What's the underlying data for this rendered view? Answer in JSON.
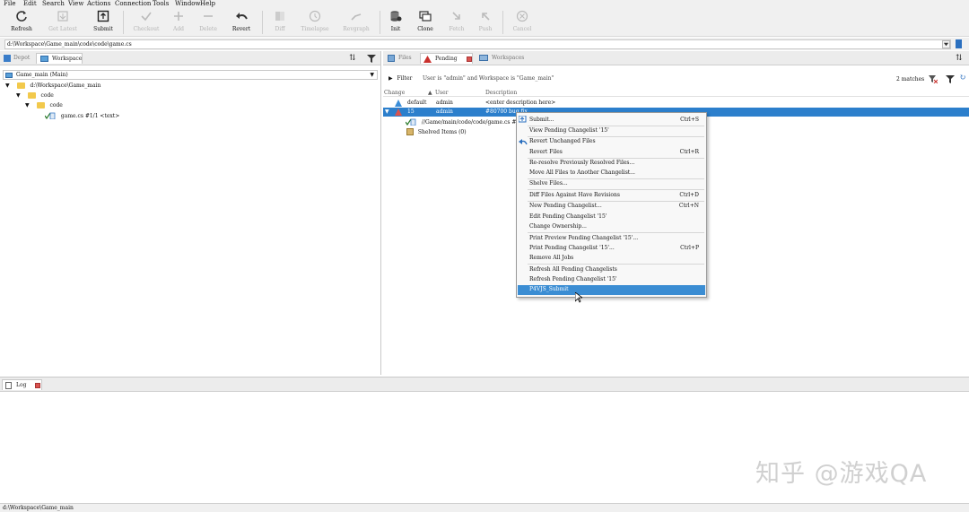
{
  "menu": [
    "File",
    "Edit",
    "Search",
    "View",
    "Actions",
    "Connection",
    "Tools",
    "Window",
    "Help"
  ],
  "toolbar": {
    "refresh": "Refresh",
    "get_latest": "Get Latest",
    "submit": "Submit",
    "checkout": "Checkout",
    "add": "Add",
    "delete": "Delete",
    "revert": "Revert",
    "diff": "Diff",
    "timelapse": "Timelapse",
    "revgraph": "Revgraph",
    "init": "Init",
    "clone": "Clone",
    "fetch": "Fetch",
    "push": "Push",
    "cancel": "Cancel"
  },
  "address": "d:\\Workspace\\Game_main\\code\\code\\game.cs",
  "left": {
    "tab_depot": "Depot",
    "tab_workspace": "Workspace",
    "workspace_select": "Game_main (Main)",
    "tree": {
      "root": "d:\\Workspace\\Game_main",
      "code1": "code",
      "code2": "code",
      "file": "game.cs #1/1 <text>"
    }
  },
  "right": {
    "tab_files": "Files",
    "tab_pending": "Pending",
    "tab_workspaces": "Workspaces",
    "filter_label": "Filter",
    "filter_text": "User is \"admin\" and Workspace is \"Game_main\"",
    "matches": "2 matches",
    "col_change": "Change",
    "col_user": "User",
    "col_description": "Description",
    "rows": [
      {
        "change": "default",
        "user": "admin",
        "description": "<enter description here>"
      },
      {
        "change": "15",
        "user": "admin",
        "description": "#80700 bug fix"
      }
    ],
    "file_path": "//Game/main/code/code/game.cs #",
    "shelved": "Shelved Items (0)"
  },
  "context_menu": {
    "items": [
      {
        "label": "Submit...",
        "shortcut": "Ctrl+S"
      },
      {
        "label": "View Pending Changelist '15'",
        "shortcut": ""
      },
      {
        "label": "Revert Unchanged Files",
        "shortcut": ""
      },
      {
        "label": "Revert Files",
        "shortcut": "Ctrl+R"
      },
      {
        "label": "Re-resolve Previously Resolved Files...",
        "shortcut": ""
      },
      {
        "label": "Move All Files to Another Changelist...",
        "shortcut": ""
      },
      {
        "label": "Shelve Files...",
        "shortcut": ""
      },
      {
        "label": "Diff Files Against Have Revisions",
        "shortcut": "Ctrl+D"
      },
      {
        "label": "New Pending Changelist...",
        "shortcut": "Ctrl+N"
      },
      {
        "label": "Edit Pending Changelist '15'",
        "shortcut": ""
      },
      {
        "label": "Change Ownership...",
        "shortcut": ""
      },
      {
        "label": "Print Preview Pending Changelist '15'...",
        "shortcut": ""
      },
      {
        "label": "Print Pending Changelist '15'...",
        "shortcut": "Ctrl+P"
      },
      {
        "label": "Remove All Jobs",
        "shortcut": ""
      },
      {
        "label": "Refresh All Pending Changelists",
        "shortcut": ""
      },
      {
        "label": "Refresh Pending Changelist '15'",
        "shortcut": ""
      },
      {
        "label": "P4VJS_Submit",
        "shortcut": ""
      }
    ]
  },
  "log_tab": "Log",
  "status": "d:\\Workspace\\Game_main",
  "watermark": "知乎 @游戏QA",
  "colors": {
    "selection": "#2c7fcc",
    "menu_highlight": "#3b8dd3",
    "toolbar_bg": "#f0f0f0"
  }
}
